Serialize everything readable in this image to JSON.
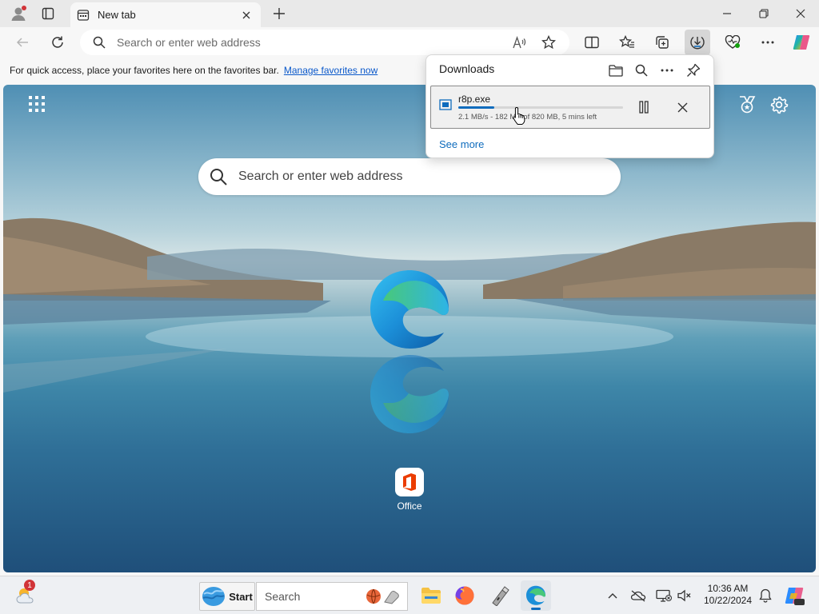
{
  "browser": {
    "tab": {
      "title": "New tab"
    },
    "address_bar": {
      "placeholder": "Search or enter web address"
    },
    "favorites_bar": {
      "message": "For quick access, place your favorites here on the favorites bar.",
      "link": "Manage favorites now"
    }
  },
  "new_tab_page": {
    "search_placeholder": "Search or enter web address",
    "quick_links": [
      {
        "label": "Office"
      }
    ]
  },
  "downloads": {
    "title": "Downloads",
    "item": {
      "filename": "r8p.exe",
      "status": "2.1 MB/s - 182 MB of 820 MB, 5 mins left",
      "progress": 0.22
    },
    "see_more": "See more"
  },
  "taskbar": {
    "weather_badge": "1",
    "start_label": "Start",
    "search_placeholder": "Search",
    "time": "10:36 AM",
    "date": "10/22/2024"
  },
  "colors": {
    "accent": "#0f6cbd",
    "link": "#0a58ca",
    "badge": "#d13438"
  },
  "icons": [
    "profile-icon",
    "workspaces-icon",
    "close-icon",
    "plus-icon",
    "minimize-icon",
    "restore-icon",
    "back-icon",
    "refresh-icon",
    "search-icon",
    "read-aloud-icon",
    "favorite-star-icon",
    "split-screen-icon",
    "favorites-icon",
    "collections-icon",
    "download-icon",
    "browser-essentials-icon",
    "more-icon",
    "copilot-icon",
    "apps-grid-icon",
    "rewards-icon",
    "settings-icon",
    "edge-logo-icon",
    "office-icon",
    "folder-icon",
    "pin-icon",
    "file-icon",
    "pause-icon",
    "cursor-icon",
    "weather-icon",
    "start-icon",
    "file-explorer-icon",
    "firefox-icon",
    "usb-tool-icon",
    "edge-icon",
    "chevron-up-icon",
    "onedrive-icon",
    "network-icon",
    "volume-icon",
    "bell-icon",
    "copilot-pre-icon"
  ]
}
